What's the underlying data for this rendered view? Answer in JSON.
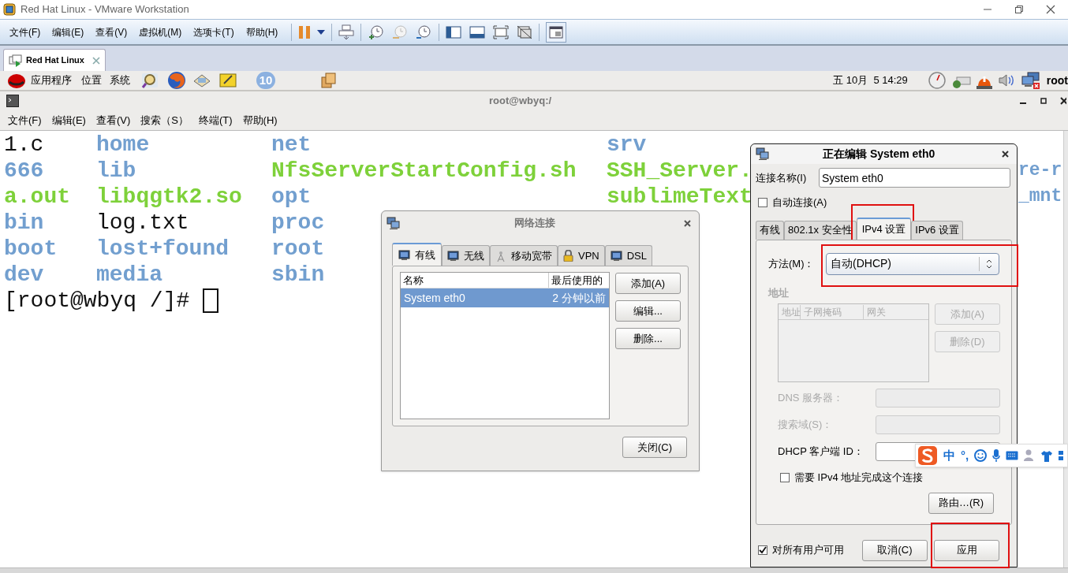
{
  "vmware": {
    "title": "Red Hat Linux - VMware Workstation",
    "menus": [
      "文件(F)",
      "编辑(E)",
      "查看(V)",
      "虚拟机(M)",
      "选项卡(T)",
      "帮助(H)"
    ],
    "tabs": [
      {
        "label": "Red Hat Linux",
        "selected": true
      }
    ]
  },
  "gnome_panel": {
    "menus": [
      "应用程序",
      "位置",
      "系统"
    ],
    "badge": "10",
    "clock": "五 10月  5 14:29",
    "user": "root"
  },
  "terminal": {
    "title": "root@wbyq:/",
    "menus": [
      "文件(F)",
      "编辑(E)",
      "查看(V)",
      "搜索（S）",
      "终端(T)",
      "帮助(H)"
    ],
    "rows": [
      [
        {
          "text": "1.c",
          "kind": "file"
        },
        {
          "text": "home",
          "kind": "dir"
        },
        {
          "text": "net",
          "kind": "dir"
        },
        {
          "text": "srv",
          "kind": "dir"
        }
      ],
      [
        {
          "text": "666",
          "kind": "dir"
        },
        {
          "text": "lib",
          "kind": "dir"
        },
        {
          "text": "NfsServerStartConfig.sh",
          "kind": "exec"
        },
        {
          "text": "SSH_Server.",
          "kind": "exec"
        },
        {
          "text": "re-r",
          "kind": "dir"
        }
      ],
      [
        {
          "text": "a.out",
          "kind": "exec"
        },
        {
          "text": "libqgtk2.so",
          "kind": "exec"
        },
        {
          "text": "opt",
          "kind": "dir"
        },
        {
          "text": "sublimeText",
          "kind": "exec"
        },
        {
          "text": "_mnt",
          "kind": "dir"
        }
      ],
      [
        {
          "text": "bin",
          "kind": "dir"
        },
        {
          "text": "log.txt",
          "kind": "file"
        },
        {
          "text": "proc",
          "kind": "dir"
        }
      ],
      [
        {
          "text": "boot",
          "kind": "dir"
        },
        {
          "text": "lost+found",
          "kind": "dir"
        },
        {
          "text": "root",
          "kind": "dir"
        }
      ],
      [
        {
          "text": "dev",
          "kind": "dir"
        },
        {
          "text": "media",
          "kind": "dir"
        },
        {
          "text": "sbin",
          "kind": "dir"
        }
      ]
    ],
    "prompt": "[root@wbyq /]#"
  },
  "network_dialog": {
    "title": "网络连接",
    "tabs": [
      {
        "label": "有线",
        "selected": true
      },
      {
        "label": "无线",
        "selected": false
      },
      {
        "label": "移动宽带",
        "selected": false
      },
      {
        "label": "VPN",
        "selected": false
      },
      {
        "label": "DSL",
        "selected": false
      }
    ],
    "columns": [
      "名称",
      "最后使用的"
    ],
    "rows": [
      {
        "name": "System eth0",
        "last_used": "2 分钟以前",
        "selected": true
      }
    ],
    "buttons": [
      "添加(A)",
      "编辑...",
      "删除..."
    ],
    "close_button": "关闭(C)"
  },
  "edit_dialog": {
    "title": "正在编辑 System eth0",
    "name_label": "连接名称(I)",
    "name_value": "System eth0",
    "auto_connect": {
      "label": "自动连接(A)",
      "checked": false
    },
    "tabs": [
      {
        "label": "有线",
        "selected": false,
        "highlighted": false
      },
      {
        "label": "802.1x 安全性",
        "selected": false,
        "highlighted": false
      },
      {
        "label": "IPv4 设置",
        "selected": true,
        "highlighted": true
      },
      {
        "label": "IPv6 设置",
        "selected": false,
        "highlighted": false
      }
    ],
    "method": {
      "label": "方法(M)：",
      "value": "自动(DHCP)",
      "highlighted": true
    },
    "address": {
      "heading": "地址",
      "columns": [
        "地址",
        "子网掩码",
        "网关"
      ],
      "buttons": [
        "添加(A)",
        "删除(D)"
      ],
      "disabled": true
    },
    "fields": [
      {
        "label": "DNS 服务器：",
        "disabled": true
      },
      {
        "label": "搜索域(S)：",
        "disabled": true
      },
      {
        "label": "DHCP 客户端 ID：",
        "disabled": false
      }
    ],
    "require_ipv4": {
      "label": "需要 IPv4 地址完成这个连接",
      "checked": false
    },
    "routes_button": "路由…(R)",
    "all_users": {
      "label": "对所有用户可用",
      "checked": true
    },
    "buttons": [
      {
        "label": "取消(C)",
        "highlighted": false
      },
      {
        "label": "应用",
        "highlighted": true
      }
    ]
  },
  "ime_bar": {
    "mode": "中",
    "punctuation": "°,"
  }
}
